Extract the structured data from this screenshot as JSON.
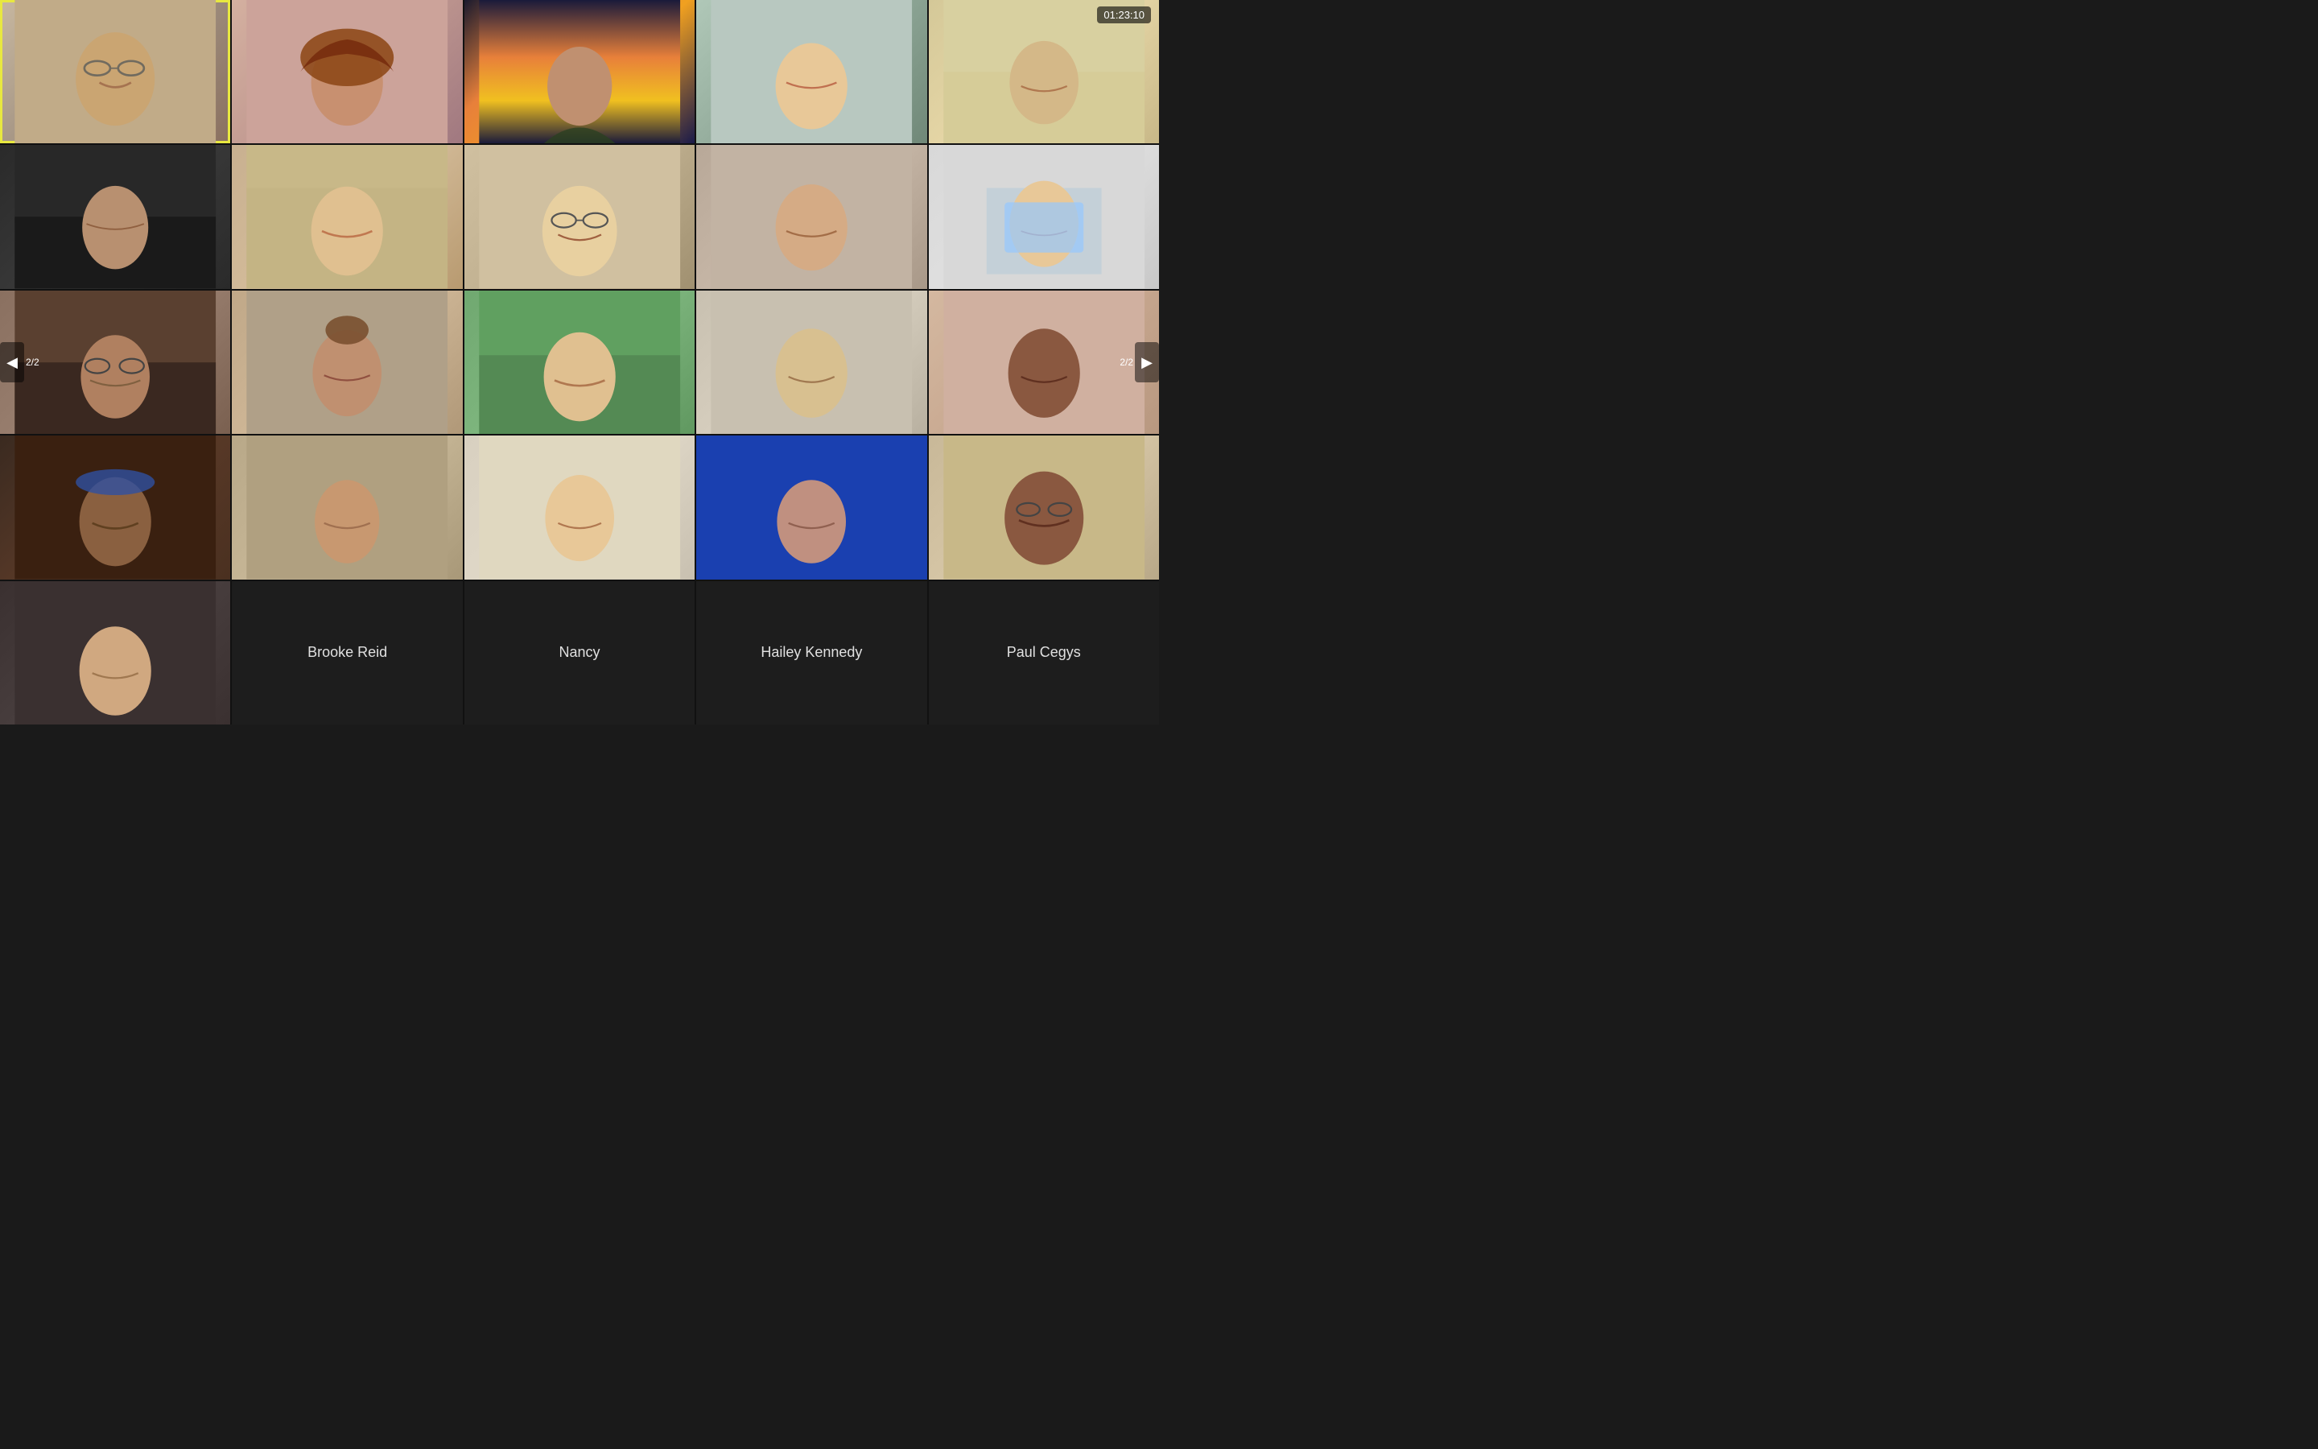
{
  "timer": "01:23:10",
  "page_current_left": "2/2",
  "page_current_right": "2/2",
  "grid": {
    "rows": 5,
    "cols": 5
  },
  "cells": [
    {
      "id": 1,
      "type": "video",
      "name": "",
      "active": true,
      "bg": "#c8b090",
      "row": 1,
      "col": 1
    },
    {
      "id": 2,
      "type": "video",
      "name": "",
      "active": false,
      "bg": "#c09888",
      "row": 1,
      "col": 2
    },
    {
      "id": 3,
      "type": "video",
      "name": "",
      "active": false,
      "bg": "#e8803a",
      "row": 1,
      "col": 3
    },
    {
      "id": 4,
      "type": "video",
      "name": "",
      "active": false,
      "bg": "#b0c0b8",
      "row": 1,
      "col": 4
    },
    {
      "id": 5,
      "type": "video",
      "name": "",
      "active": false,
      "bg": "#d8c890",
      "row": 1,
      "col": 5
    },
    {
      "id": 6,
      "type": "video",
      "name": "",
      "active": false,
      "bg": "#303030",
      "row": 2,
      "col": 1
    },
    {
      "id": 7,
      "type": "video",
      "name": "",
      "active": false,
      "bg": "#c8b090",
      "row": 2,
      "col": 2
    },
    {
      "id": 8,
      "type": "video",
      "name": "",
      "active": false,
      "bg": "#c8b898",
      "row": 2,
      "col": 3
    },
    {
      "id": 9,
      "type": "video",
      "name": "",
      "active": false,
      "bg": "#b8a898",
      "row": 2,
      "col": 4
    },
    {
      "id": 10,
      "type": "video",
      "name": "",
      "active": false,
      "bg": "#d4d4d0",
      "row": 2,
      "col": 5
    },
    {
      "id": 11,
      "type": "video",
      "name": "",
      "active": false,
      "bg": "#8a7060",
      "row": 3,
      "col": 1
    },
    {
      "id": 12,
      "type": "video",
      "name": "",
      "active": false,
      "bg": "#c0a880",
      "row": 3,
      "col": 2
    },
    {
      "id": 13,
      "type": "video",
      "name": "",
      "active": false,
      "bg": "#70a860",
      "row": 3,
      "col": 3
    },
    {
      "id": 14,
      "type": "video",
      "name": "",
      "active": false,
      "bg": "#c8c0a8",
      "row": 3,
      "col": 4
    },
    {
      "id": 15,
      "type": "video",
      "name": "",
      "active": false,
      "bg": "#d0b090",
      "row": 3,
      "col": 5
    },
    {
      "id": 16,
      "type": "video",
      "name": "",
      "active": false,
      "bg": "#4a3020",
      "row": 4,
      "col": 1
    },
    {
      "id": 17,
      "type": "video",
      "name": "",
      "active": false,
      "bg": "#b8a880",
      "row": 4,
      "col": 2
    },
    {
      "id": 18,
      "type": "video",
      "name": "",
      "active": false,
      "bg": "#d8d0b8",
      "row": 4,
      "col": 3
    },
    {
      "id": 19,
      "type": "video",
      "name": "",
      "active": false,
      "bg": "#1a40b0",
      "row": 4,
      "col": 4
    },
    {
      "id": 20,
      "type": "video",
      "name": "",
      "active": false,
      "bg": "#c8b890",
      "row": 4,
      "col": 5
    },
    {
      "id": 21,
      "type": "video",
      "name": "",
      "active": false,
      "bg": "#3a3030",
      "row": 5,
      "col": 1
    },
    {
      "id": 22,
      "type": "nameplate",
      "name": "Brooke Reid",
      "active": false,
      "bg": "#1e1e1e",
      "row": 5,
      "col": 2
    },
    {
      "id": 23,
      "type": "nameplate",
      "name": "Nancy",
      "active": false,
      "bg": "#1e1e1e",
      "row": 5,
      "col": 3
    },
    {
      "id": 24,
      "type": "nameplate",
      "name": "Hailey Kennedy",
      "active": false,
      "bg": "#1e1e1e",
      "row": 5,
      "col": 4
    },
    {
      "id": 25,
      "type": "nameplate",
      "name": "Paul Cegys",
      "active": false,
      "bg": "#1e1e1e",
      "row": 5,
      "col": 5
    }
  ],
  "nav": {
    "left_arrow": "◀",
    "right_arrow": "▶",
    "left_page": "2/2",
    "right_page": "2/2"
  }
}
